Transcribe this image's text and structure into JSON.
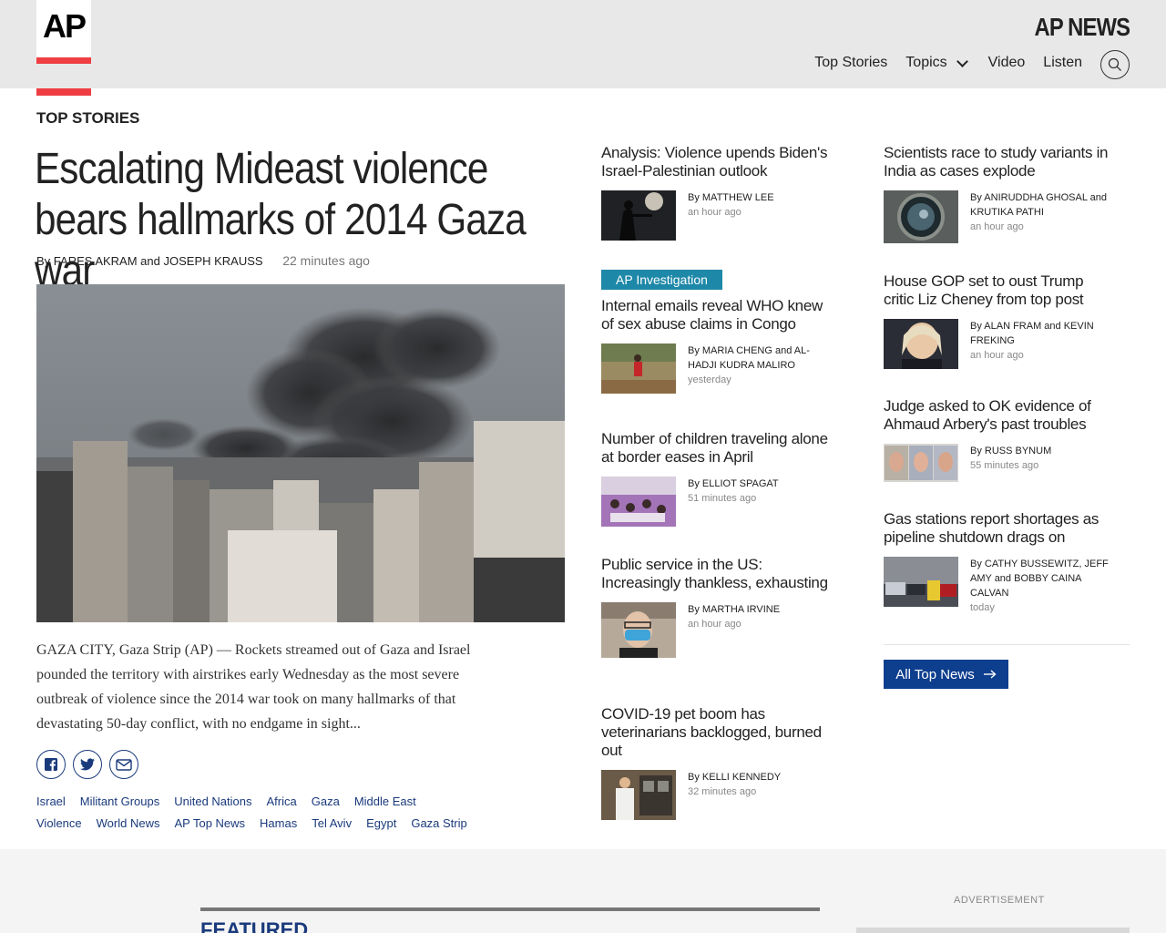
{
  "header": {
    "logo": "AP",
    "brand": "AP NEWS",
    "nav": [
      "Top Stories",
      "Topics",
      "Video",
      "Listen"
    ]
  },
  "section_label": "TOP STORIES",
  "main_story": {
    "title": "Escalating Mideast violence bears hallmarks of 2014 Gaza war",
    "byline_prefix": "By",
    "author1": "FARES AKRAM",
    "byline_and": "and",
    "author2": "JOSEPH KRAUSS",
    "time": "22 minutes ago",
    "summary": "GAZA CITY, Gaza Strip (AP) — Rockets streamed out of Gaza and Israel pounded the territory with airstrikes early Wednesday as the most severe outbreak of violence since the 2014 war took on many hallmarks of that devastating 50-day conflict, with no endgame in sight...",
    "tags_row1": [
      "Israel",
      "Militant Groups",
      "United Nations",
      "Africa",
      "Gaza",
      "Middle East"
    ],
    "tags_row2": [
      "Violence",
      "World News",
      "AP Top News",
      "Hamas",
      "Tel Aviv",
      "Egypt",
      "Gaza Strip"
    ]
  },
  "col2": [
    {
      "title": "Analysis: Violence upends Biden's Israel-Palestinian outlook",
      "byline": "By MATTHEW LEE",
      "when": "an hour ago"
    },
    {
      "badge": "AP Investigation",
      "title": "Internal emails reveal WHO knew of sex abuse claims in Congo",
      "byline": "By MARIA CHENG and AL-HADJI KUDRA MALIRO",
      "when": "yesterday"
    },
    {
      "title": "Number of children traveling alone at border eases in April",
      "byline": "By ELLIOT SPAGAT",
      "when": "51 minutes ago"
    },
    {
      "title": "Public service in the US: Increasingly thankless, exhausting",
      "byline": "By MARTHA IRVINE",
      "when": "an hour ago"
    },
    {
      "title": "COVID-19 pet boom has veterinarians backlogged, burned out",
      "byline": "By KELLI KENNEDY",
      "when": "32 minutes ago"
    }
  ],
  "col3": [
    {
      "title": "Scientists race to study variants in India as cases explode",
      "byline": "By ANIRUDDHA GHOSAL and KRUTIKA PATHI",
      "when": "an hour ago"
    },
    {
      "title": "House GOP set to oust Trump critic Liz Cheney from top post",
      "byline": "By ALAN FRAM and KEVIN FREKING",
      "when": "an hour ago"
    },
    {
      "title": "Judge asked to OK evidence of Ahmaud Arbery's past troubles",
      "byline": "By RUSS BYNUM",
      "when": "55 minutes ago"
    },
    {
      "title": "Gas stations report shortages as pipeline shutdown drags on",
      "byline": "By CATHY BUSSEWITZ, JEFF AMY and BOBBY CAINA CALVAN",
      "when": "today"
    }
  ],
  "all_top_news": "All Top News",
  "featured": "FEATURED",
  "advertisement": "ADVERTISEMENT"
}
